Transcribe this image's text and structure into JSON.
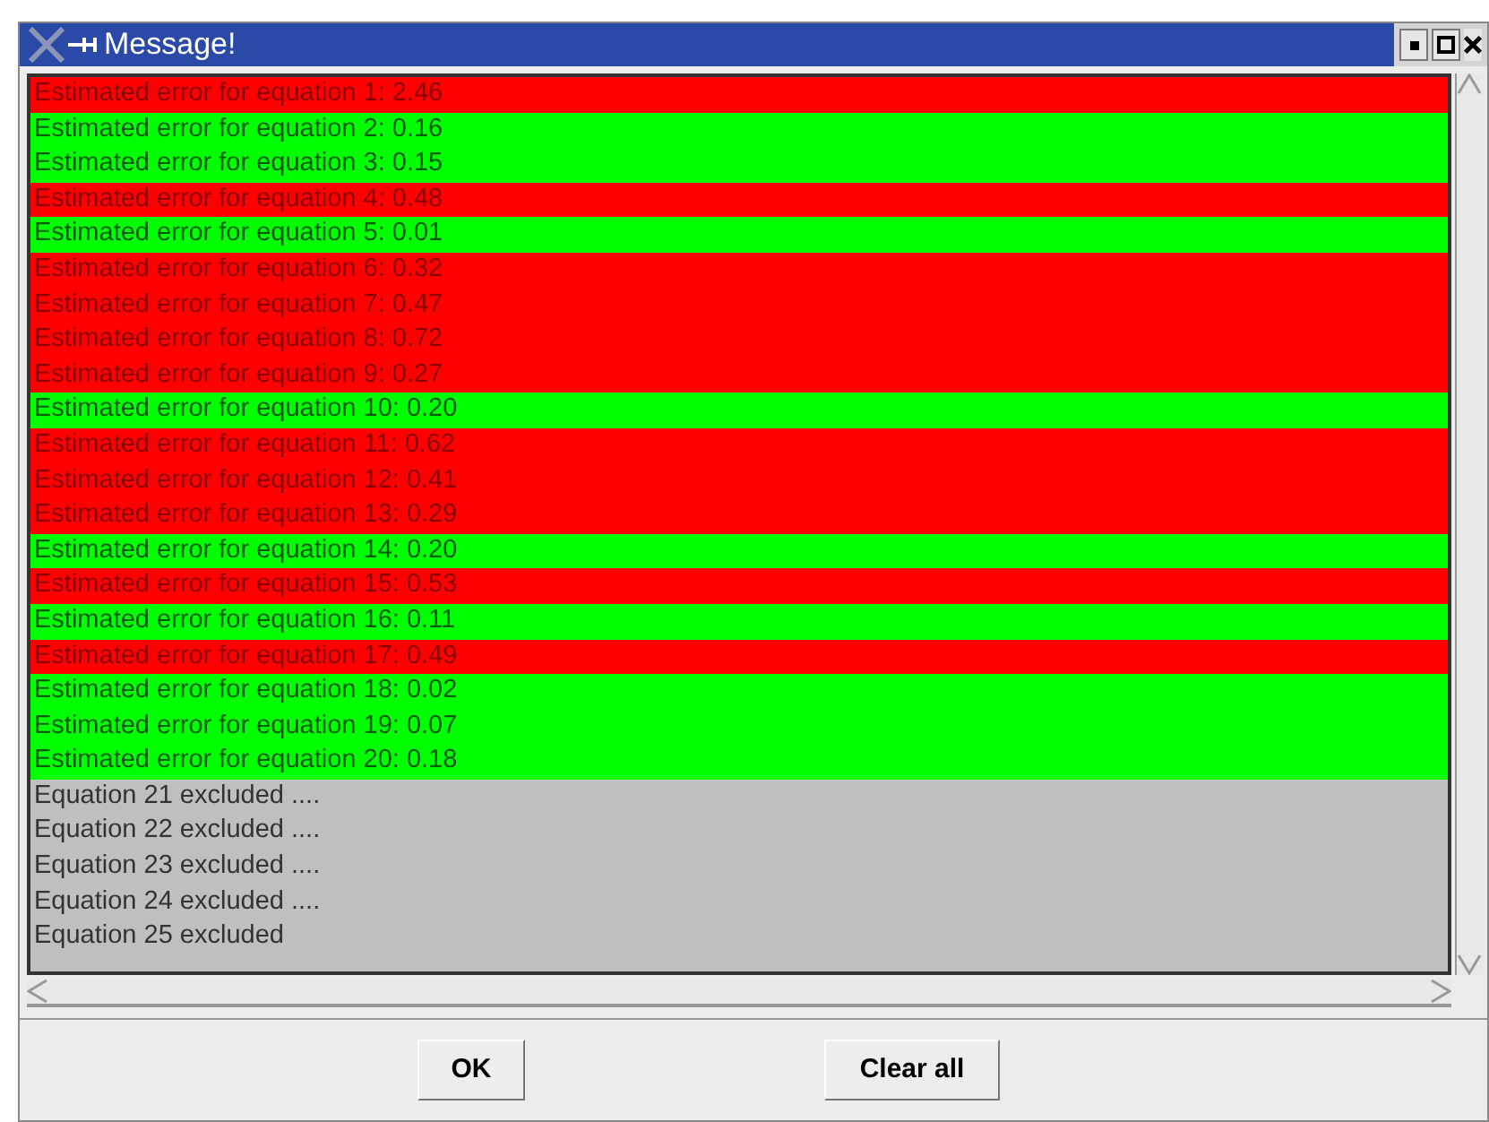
{
  "window": {
    "title": "Message!"
  },
  "lines": [
    {
      "text": "Estimated error for equation 1: 2.46",
      "kind": "error"
    },
    {
      "text": "Estimated error for equation 2: 0.16",
      "kind": "ok"
    },
    {
      "text": "Estimated error for equation 3: 0.15",
      "kind": "ok"
    },
    {
      "text": "Estimated error for equation 4: 0.48",
      "kind": "error"
    },
    {
      "text": "Estimated error for equation 5: 0.01",
      "kind": "ok"
    },
    {
      "text": "Estimated error for equation 6: 0.32",
      "kind": "error"
    },
    {
      "text": "Estimated error for equation 7: 0.47",
      "kind": "error"
    },
    {
      "text": "Estimated error for equation 8: 0.72",
      "kind": "error"
    },
    {
      "text": "Estimated error for equation 9: 0.27",
      "kind": "error"
    },
    {
      "text": "Estimated error for equation 10: 0.20",
      "kind": "ok"
    },
    {
      "text": "Estimated error for equation 11: 0.62",
      "kind": "error"
    },
    {
      "text": "Estimated error for equation 12: 0.41",
      "kind": "error"
    },
    {
      "text": "Estimated error for equation 13: 0.29",
      "kind": "error"
    },
    {
      "text": "Estimated error for equation 14: 0.20",
      "kind": "ok"
    },
    {
      "text": "Estimated error for equation 15: 0.53",
      "kind": "error"
    },
    {
      "text": "Estimated error for equation 16: 0.11",
      "kind": "ok"
    },
    {
      "text": "Estimated error for equation 17: 0.49",
      "kind": "error"
    },
    {
      "text": "Estimated error for equation 18: 0.02",
      "kind": "ok"
    },
    {
      "text": "Estimated error for equation 19: 0.07",
      "kind": "ok"
    },
    {
      "text": "Estimated error for equation 20: 0.18",
      "kind": "ok"
    },
    {
      "text": "Equation 21 excluded ....",
      "kind": "excluded"
    },
    {
      "text": "Equation 22 excluded ....",
      "kind": "excluded"
    },
    {
      "text": "Equation 23 excluded ....",
      "kind": "excluded"
    },
    {
      "text": "Equation 24 excluded ....",
      "kind": "excluded"
    },
    {
      "text": "Equation 25 excluded",
      "kind": "excluded"
    }
  ],
  "buttons": [
    "OK",
    "Clear all"
  ]
}
